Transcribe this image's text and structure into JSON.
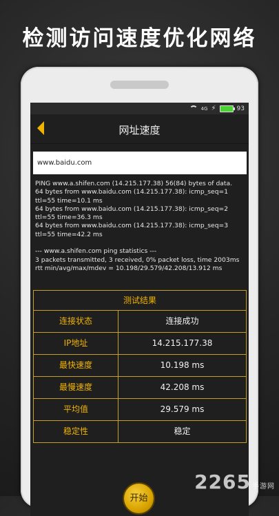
{
  "headline": "检测访问速度优化网络",
  "status_bar": {
    "battery_level": "93",
    "signal_text": "4G"
  },
  "app_bar": {
    "title": "网址速度",
    "back_icon": "chevron-left-icon"
  },
  "url_input": {
    "value": "www.baidu.com"
  },
  "ping_log": "PING www.a.shifen.com (14.215.177.38) 56(84) bytes of data.\n64 bytes from www.baidu.com (14.215.177.38): icmp_seq=1\nttl=55 time=10.1 ms\n64 bytes from www.baidu.com (14.215.177.38): icmp_seq=2\nttl=55 time=36.3 ms\n64 bytes from www.baidu.com (14.215.177.38): icmp_seq=3\nttl=55 time=42.2 ms\n\n--- www.a.shifen.com ping statistics ---\n3 packets transmitted, 3 received, 0% packet loss, time 2003ms\nrtt min/avg/max/mdev = 10.198/29.579/42.208/13.912 ms",
  "results": {
    "title": "测试结果",
    "rows": [
      {
        "key": "连接状态",
        "value": "连接成功"
      },
      {
        "key": "IP地址",
        "value": "14.215.177.38"
      },
      {
        "key": "最快速度",
        "value": "10.198 ms"
      },
      {
        "key": "最慢速度",
        "value": "42.208 ms"
      },
      {
        "key": "平均值",
        "value": "29.579 ms"
      },
      {
        "key": "稳定性",
        "value": "稳定"
      }
    ]
  },
  "start_button": {
    "label": "开始"
  },
  "watermark": {
    "text": "2265",
    "sub": "手游网"
  },
  "colors": {
    "accent": "#f0b400",
    "border": "#c7a227",
    "screen_bg": "#1f1f1f"
  }
}
